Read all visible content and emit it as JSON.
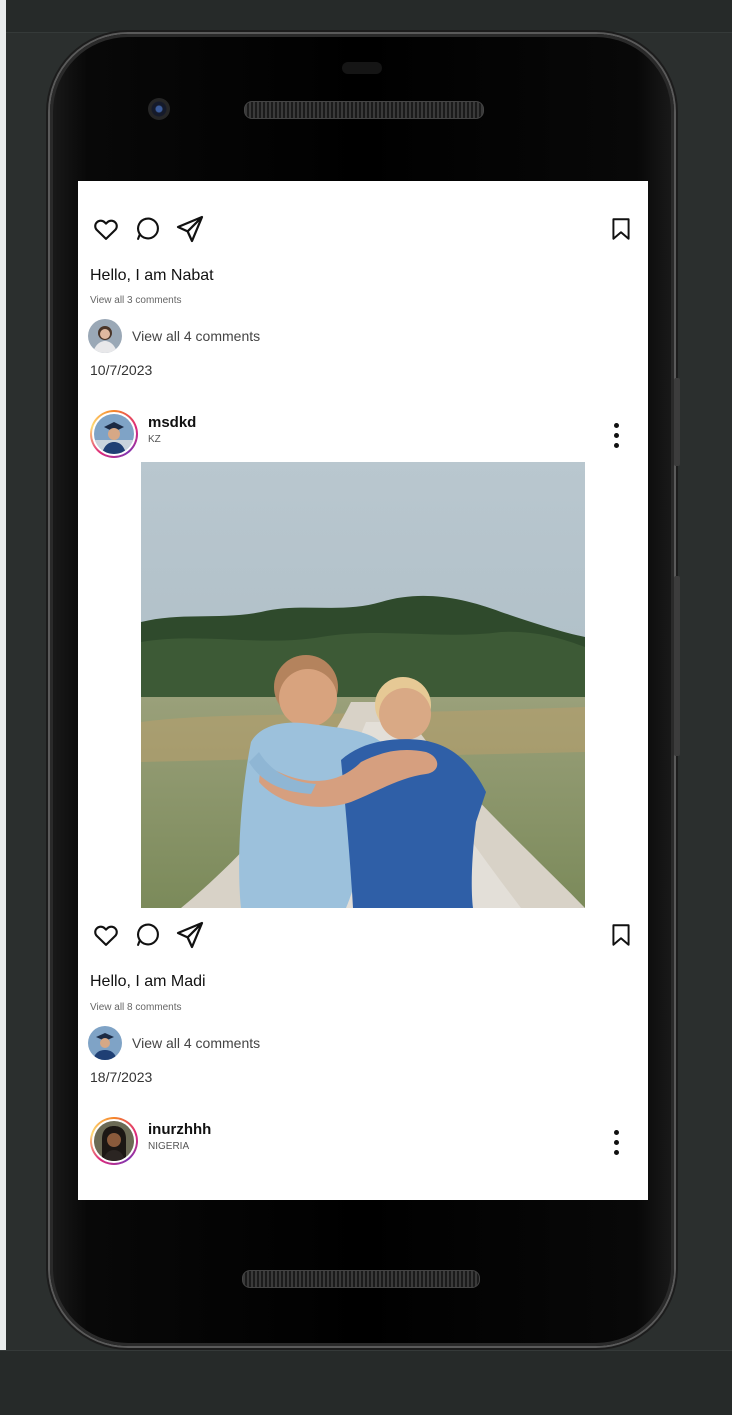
{
  "feed": {
    "post1": {
      "caption": "Hello, I am Nabat",
      "view_all_small": "View all 3 comments",
      "comment_row_text": "View all 4 comments",
      "date": "10/7/2023"
    },
    "post2": {
      "username": "msdkd",
      "location": "KZ",
      "caption": "Hello, I am Madi",
      "view_all_small": "View all 8 comments",
      "comment_row_text": "View all 4 comments",
      "date": "18/7/2023"
    },
    "post3": {
      "username": "inurzhhh",
      "location": "NIGERIA"
    }
  },
  "icons": {
    "like": "heart-icon",
    "comment": "comment-icon",
    "share": "send-icon",
    "save": "bookmark-icon",
    "more": "more-vertical-icon"
  },
  "colors": {
    "story_ring_start": "#f58529",
    "story_ring_mid": "#dd2a7b",
    "story_ring_end": "#8134af",
    "screen_bg": "#ffffff",
    "page_bg": "#2b2f2e"
  }
}
